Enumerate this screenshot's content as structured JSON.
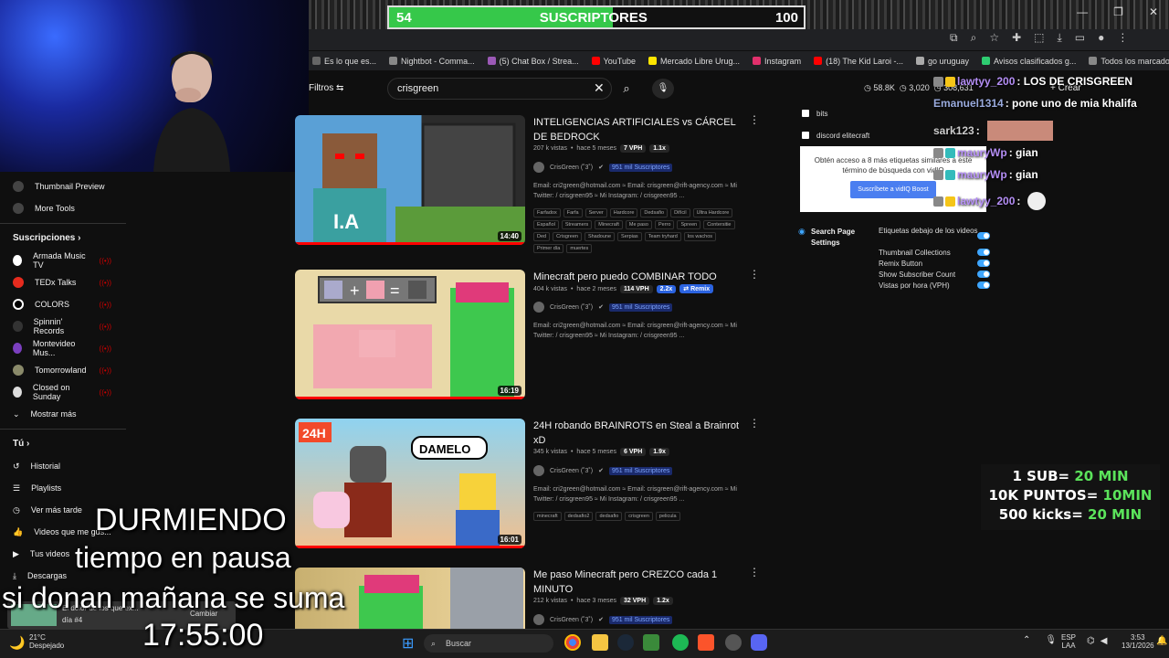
{
  "sub_goal": {
    "current": "54",
    "label": "SUSCRIPTORES",
    "goal": "100",
    "progress_fraction": 0.54
  },
  "bookmarks": [
    "Es lo que es...",
    "Nightbot - Comma...",
    "(5) Chat Box / Strea...",
    "YouTube",
    "Mercado Libre Urug...",
    "Instagram",
    "(18) The Kid Laroi -...",
    "go uruguay",
    "Avisos clasificados g...",
    "Todos los marcadores"
  ],
  "search": {
    "filtros": "Filtros",
    "query": "crisgreen",
    "stats_a": "58.8K",
    "stats_b": "3,020",
    "stats_c": "308,631",
    "create": "Crear"
  },
  "sidebar": {
    "top_items": [
      "Thumbnail Preview",
      "More Tools"
    ],
    "subs_header": "Suscripciones",
    "subs": [
      "Armada Music TV",
      "TEDx Talks",
      "COLORS",
      "Spinnin' Records",
      "Montevideo Mus...",
      "Tomorrowland",
      "Closed on Sunday"
    ],
    "more": "Mostrar más",
    "you_header": "Tú",
    "you_items": [
      "Historial",
      "Playlists",
      "Ver más tarde",
      "Videos que me gus...",
      "Tus videos",
      "Descargas"
    ]
  },
  "videos": [
    {
      "title": "INTELIGENCIAS ARTIFICIALES vs CÁRCEL DE BEDROCK",
      "views": "207 k vistas",
      "ago": "hace 5 meses",
      "vph": "7 VPH",
      "x": "1.1x",
      "channel": "CrisGreen (˚3˚)",
      "subs": "951 mil Suscriptores",
      "desc": "Email: cri2green@hotmail.com ≈ Email: crisgreen@rift-agency.com ≈ Mi Twitter: / crisgreen95 ≈ Mi Instagram: / crisgreen95 ...",
      "duration": "14:40",
      "tags": [
        "Farfadox",
        "Farfa",
        "Server",
        "Hardcore",
        "Dedsafio",
        "Difícil",
        "Ultra Hardcore",
        "Español",
        "Streamers",
        "Minecraft",
        "Me paso",
        "Perro",
        "Spreen",
        "Contersitie",
        "Ded",
        "Crisgreen",
        "Shadoune",
        "Serpias",
        "Team tryhard",
        "los wachos",
        "Primer día",
        "muertes"
      ]
    },
    {
      "title": "Minecraft pero puedo COMBINAR TODO",
      "views": "404 k vistas",
      "ago": "hace 2 meses",
      "vph": "114 VPH",
      "x": "2.2x",
      "remix": "Remix",
      "channel": "CrisGreen (˚3˚)",
      "subs": "951 mil Suscriptores",
      "desc": "Email: cri2green@hotmail.com ≈ Email: crisgreen@rift-agency.com ≈ Mi Twitter: / crisgreen95 ≈ Mi Instagram: / crisgreen95 ...",
      "duration": "16:19"
    },
    {
      "title": "24H robando BRAINROTS en Steal a Brainrot xD",
      "views": "345 k vistas",
      "ago": "hace 5 meses",
      "vph": "6 VPH",
      "x": "1.9x",
      "channel": "CrisGreen (˚3˚)",
      "subs": "951 mil Suscriptores",
      "desc": "Email: cri2green@hotmail.com ≈ Email: crisgreen@rift-agency.com ≈ Mi Twitter: / crisgreen95 ≈ Mi Instagram: / crisgreen95 ...",
      "duration": "16:01",
      "tags": [
        "minecraft",
        "dedsafio2",
        "dedsafio",
        "crisgreen",
        "pelicula"
      ],
      "thumb_text_a": "24H",
      "thumb_text_b": "DAMELO"
    },
    {
      "title": "Me paso Minecraft pero CREZCO cada 1 MINUTO",
      "views": "212 k vistas",
      "ago": "hace 3 meses",
      "vph": "32 VPH",
      "x": "1.2x",
      "channel": "CrisGreen (˚3˚)",
      "subs": "951 mil Suscriptores"
    }
  ],
  "panel": {
    "checks": [
      "bits",
      "discord elitecraft"
    ],
    "vidiq_text": "Obtén acceso a 8 más etiquetas similares a este término de búsqueda con vidIQ",
    "vidiq_btn": "Suscríbete a vidIQ Boost",
    "settings_label": "Search Page Settings",
    "settings": [
      "Etiquetas debajo de los videos",
      "Thumbnail Collections",
      "Remix Button",
      "Show Subscriber Count",
      "Vistas por hora (VPH)"
    ]
  },
  "chat": [
    {
      "user": "lawtyy_200",
      "msg": ": LOS DE CRISGREEN"
    },
    {
      "user": "Emanuel1314",
      "msg": ": pone uno de mia khalifa"
    },
    {
      "user": "sark123",
      "msg": ":"
    },
    {
      "user": "mauryWp",
      "msg": ": gian"
    },
    {
      "user": "mauryWp",
      "msg": ": gian"
    },
    {
      "user": "lawtyy_200",
      "msg": ":"
    }
  ],
  "rules": {
    "l1a": "1 SUB=",
    "l1b": "20 MIN",
    "l2a": "10K PUNTOS=",
    "l2b": "10MIN",
    "l3a": "500 kicks=",
    "l3b": "20 MIN"
  },
  "overlay": {
    "status": "DURMIENDO",
    "paused": "tiempo en pausa",
    "donate": "si donan mañana se suma",
    "timer": "17:55:00",
    "notif_a": "El dolor de los que ex...",
    "notif_b": "día #4",
    "notif_btn": "Cambiar"
  },
  "taskbar": {
    "temp": "21°C",
    "weather": "Despejado",
    "search": "Buscar",
    "lang_a": "ESP",
    "lang_b": "LAA",
    "time": "3:53",
    "date": "13/1/2026"
  }
}
